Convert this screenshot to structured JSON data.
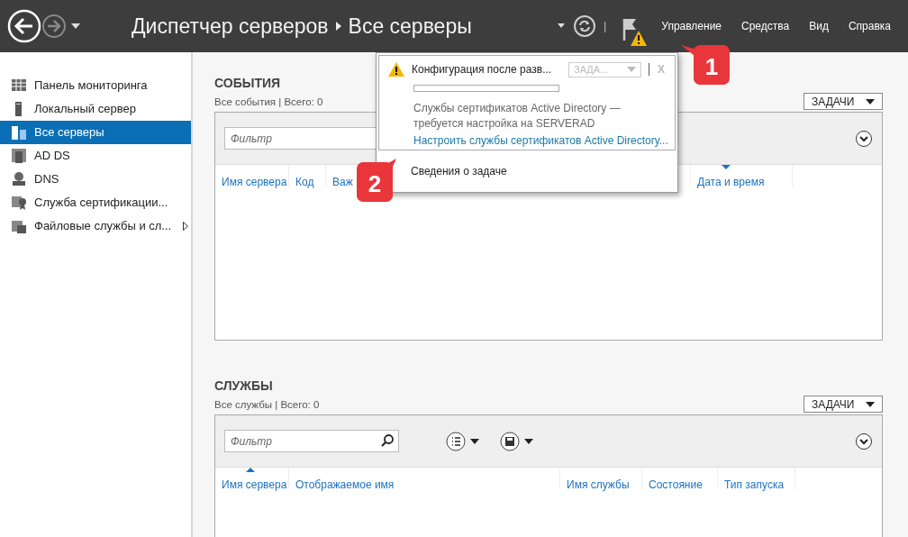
{
  "header": {
    "breadcrumbs": [
      "Диспетчер серверов",
      "Все серверы"
    ],
    "separator": "|",
    "notification_warning": true,
    "menu": [
      "Управление",
      "Средства",
      "Вид",
      "Справка"
    ]
  },
  "sidebar": {
    "items": [
      {
        "label": "Панель мониторинга",
        "selected": false,
        "has_submenu": false
      },
      {
        "label": "Локальный сервер",
        "selected": false,
        "has_submenu": false
      },
      {
        "label": "Все серверы",
        "selected": true,
        "has_submenu": false
      },
      {
        "label": "AD DS",
        "selected": false,
        "has_submenu": false
      },
      {
        "label": "DNS",
        "selected": false,
        "has_submenu": false
      },
      {
        "label": "Служба сертификации...",
        "selected": false,
        "has_submenu": false
      },
      {
        "label": "Файловые службы и сл...",
        "selected": false,
        "has_submenu": true
      }
    ]
  },
  "sections": [
    {
      "title": "СОБЫТИЯ",
      "subtitle": "Все события | Всего: 0",
      "tasks_button": "ЗАДАЧИ",
      "filter": {
        "placeholder": "Фильтр"
      },
      "tools_visible": false,
      "columns": [
        {
          "label": "Имя сервера",
          "sorted_asc": false,
          "sorted_desc": false
        },
        {
          "label": "Код",
          "sorted_asc": false,
          "sorted_desc": false
        },
        {
          "label": "Важ",
          "sorted_asc": false,
          "sorted_desc": false
        },
        {
          "label": "Дата и время",
          "sorted_asc": false,
          "sorted_desc": true
        }
      ]
    },
    {
      "title": "СЛУЖБЫ",
      "subtitle": "Все службы | Всего: 0",
      "tasks_button": "ЗАДАЧИ",
      "filter": {
        "placeholder": "Фильтр"
      },
      "tools_visible": true,
      "columns": [
        {
          "label": "Имя сервера",
          "sorted_asc": true,
          "sorted_desc": false
        },
        {
          "label": "Отображаемое имя",
          "sorted_asc": false,
          "sorted_desc": false
        },
        {
          "label": "Имя службы",
          "sorted_asc": false,
          "sorted_desc": false
        },
        {
          "label": "Состояние",
          "sorted_asc": false,
          "sorted_desc": false
        },
        {
          "label": "Тип запуска",
          "sorted_asc": false,
          "sorted_desc": false
        }
      ]
    }
  ],
  "notification": {
    "title": "Конфигурация после разв...",
    "tasks_button": "ЗАДА...",
    "close": "X",
    "level": 0,
    "message": "Службы сертификатов Active Directory — требуется настройка на SERVERAD",
    "link": "Настроить службы сертификатов Active Directory...",
    "footer": "Сведения о задаче"
  },
  "callouts": [
    "1",
    "2"
  ]
}
